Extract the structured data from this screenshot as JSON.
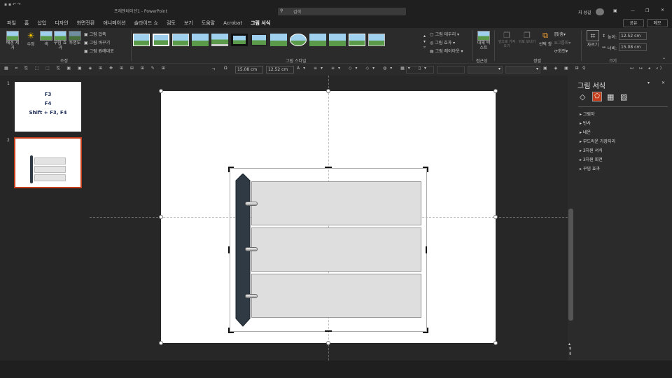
{
  "titlebar": {
    "title": "프레젠테이션1 - PowerPoint",
    "search_placeholder": "검색",
    "user": "지 성길"
  },
  "tabs": [
    "파일",
    "홈",
    "삽입",
    "디자인",
    "화면전환",
    "애니메이션",
    "슬라이드 쇼",
    "검토",
    "보기",
    "도움말",
    "Acrobat",
    "그림 서식"
  ],
  "share": {
    "share_label": "공유",
    "memo_label": "메모"
  },
  "ribbon": {
    "adjust": {
      "remove_bg": "배경 제거",
      "corrections": "수정",
      "color": "색",
      "artistic": "꾸밈 효과",
      "transparency": "투명도",
      "compress": "그림 압축",
      "change": "그림 바꾸기",
      "reset": "그림 원래대로",
      "group_label": "조정"
    },
    "styles": {
      "group_label": "그림 스타일",
      "border": "그림 테두리",
      "effects": "그림 효과",
      "layout": "그림 레이아웃"
    },
    "accessibility": {
      "alt_text": "대체 텍스트",
      "group_label": "접근성"
    },
    "arrange": {
      "bring_forward": "앞으로 가져오기",
      "send_backward": "뒤로 보내기",
      "selection_pane": "선택 창",
      "align": "맞춤",
      "group": "그룹화",
      "rotate": "회전",
      "group_label": "정렬"
    },
    "size": {
      "crop": "자르기",
      "height_label": "높이:",
      "height_value": "12.52 cm",
      "width_label": "너비:",
      "width_value": "15.08 cm",
      "group_label": "크기"
    }
  },
  "toolbar2": {
    "width_value": "15.08 cm",
    "height_value": "12.52 cm"
  },
  "slides": [
    {
      "number": "1",
      "lines": [
        "F3",
        "F4",
        "Shift + F3, F4"
      ]
    },
    {
      "number": "2"
    }
  ],
  "format_pane": {
    "title": "그림 서식",
    "items": [
      "그림자",
      "반사",
      "네온",
      "부드러운 가장자리",
      "3차원 서식",
      "3차원 회전",
      "꾸밈 효과"
    ]
  },
  "colors": {
    "accent": "#c43e1c",
    "binder": "#2f3a44"
  }
}
